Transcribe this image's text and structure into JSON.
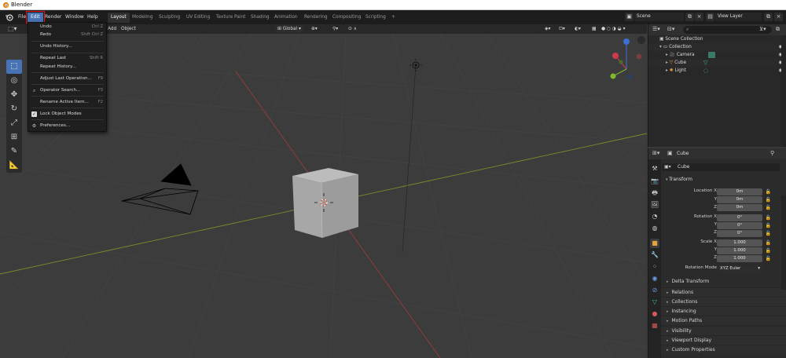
{
  "window": {
    "title": "Blender"
  },
  "topbar": {
    "menus": [
      "File",
      "Edit",
      "Render",
      "Window",
      "Help"
    ],
    "active_menu": "Edit",
    "workspaces": [
      "Layout",
      "Modeling",
      "Sculpting",
      "UV Editing",
      "Texture Paint",
      "Shading",
      "Animation",
      "Rendering",
      "Compositing",
      "Scripting"
    ],
    "active_workspace": "Layout",
    "add_tab": "+",
    "scene": "Scene",
    "view_layer": "View Layer"
  },
  "viewport_header": {
    "add": "Add",
    "object": "Object",
    "transform_orientation": "Global"
  },
  "edit_menu": {
    "items": [
      {
        "label": "Undo",
        "shortcut": "Ctrl Z"
      },
      {
        "label": "Redo",
        "shortcut": "Shift Ctrl Z"
      },
      {
        "label": "Undo History...",
        "shortcut": ""
      },
      {
        "label": "Repeat Last",
        "shortcut": "Shift R"
      },
      {
        "label": "Repeat History...",
        "shortcut": ""
      },
      {
        "label": "Adjust Last Operation...",
        "shortcut": "F9"
      },
      {
        "label": "Operator Search...",
        "shortcut": "F3"
      },
      {
        "label": "Rename Active Item...",
        "shortcut": "F2"
      },
      {
        "label": "Lock Object Modes",
        "shortcut": ""
      },
      {
        "label": "Preferences...",
        "shortcut": ""
      }
    ]
  },
  "outliner": {
    "root": "Scene Collection",
    "collection": "Collection",
    "objects": [
      "Camera",
      "Cube",
      "Light"
    ]
  },
  "properties": {
    "object_name": "Cube",
    "data_name": "Cube",
    "transform": {
      "title": "Transform",
      "location_label": "Location X",
      "rotation_label": "Rotation X",
      "scale_label": "Scale X",
      "y_label": "Y",
      "z_label": "Z",
      "location": [
        "0m",
        "0m",
        "0m"
      ],
      "rotation": [
        "0°",
        "0°",
        "0°"
      ],
      "scale": [
        "1.000",
        "1.000",
        "1.000"
      ],
      "rotation_mode_label": "Rotation Mode",
      "rotation_mode": "XYZ Euler",
      "delta": "Delta Transform"
    },
    "panels": [
      "Relations",
      "Collections",
      "Instancing",
      "Motion Paths",
      "Visibility",
      "Viewport Display",
      "Custom Properties"
    ]
  },
  "colors": {
    "accent": "#4772b3",
    "highlight_border": "#e11111",
    "x_axis": "#9b3a3a",
    "y_axis": "#7b8b2a"
  }
}
